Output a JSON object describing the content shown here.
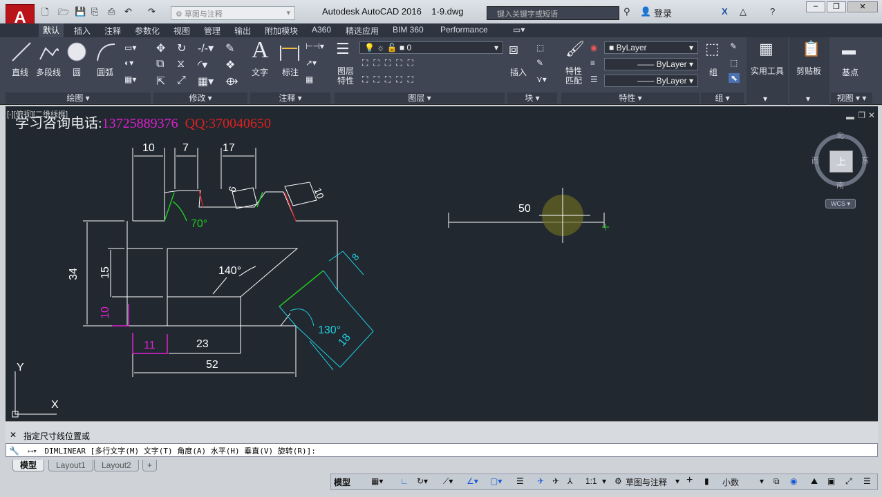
{
  "title": {
    "app": "Autodesk AutoCAD 2016",
    "file": "1-9.dwg",
    "workspace": "草图与注释"
  },
  "search": {
    "placeholder": "键入关键字或短语"
  },
  "user": {
    "login": "登录"
  },
  "tabs": [
    "默认",
    "插入",
    "注释",
    "参数化",
    "视图",
    "管理",
    "输出",
    "附加模块",
    "A360",
    "精选应用",
    "BIM 360",
    "Performance"
  ],
  "ribbon": {
    "draw": {
      "line": "直线",
      "polyline": "多段线",
      "circle": "圆",
      "arc": "圆弧",
      "title": "绘图"
    },
    "modify": {
      "title": "修改"
    },
    "annotation": {
      "text": "文字",
      "dim": "标注",
      "title": "注释"
    },
    "layers": {
      "props": "图层特性",
      "current": "0",
      "title": "图层"
    },
    "block": {
      "insert": "插入",
      "title": "块"
    },
    "properties": {
      "match": "特性匹配",
      "color": "ByLayer",
      "linetype": "ByLayer",
      "lineweight": "ByLayer",
      "title": "特性"
    },
    "group": {
      "group": "组",
      "title": "组"
    },
    "utilities": {
      "label": "实用工具"
    },
    "clipboard": {
      "label": "剪贴板"
    },
    "view": {
      "base": "基点",
      "title": "视图"
    }
  },
  "canvas": {
    "viewport_label": "[-][俯视][二维线框]",
    "contact_prefix": "学习咨询电话:",
    "phone": "13725889376",
    "qq": "QQ:370040650",
    "dims": {
      "d10": "10",
      "d7": "7",
      "d17": "17",
      "d6": "6",
      "d10b": "10",
      "d70": "70°",
      "d34": "34",
      "d15": "15",
      "d140": "140°",
      "d8": "8",
      "d10c": "10",
      "d130": "130°",
      "d11": "11",
      "d23": "23",
      "d18": "18",
      "d52": "52",
      "d50": "50"
    },
    "axis": {
      "y": "Y",
      "x": "X"
    },
    "viewcube": {
      "n": "北",
      "s": "南",
      "e": "东",
      "w": "西",
      "top": "上",
      "wcs": "WCS"
    }
  },
  "command": {
    "prompt": "指定尺寸线位置或",
    "line": "DIMLINEAR [多行文字(M) 文字(T) 角度(A) 水平(H) 垂直(V) 旋转(R)]:"
  },
  "layouts": [
    "模型",
    "Layout1",
    "Layout2"
  ],
  "status": {
    "model": "模型",
    "scale": "1:1",
    "workspace": "草图与注释",
    "units": "小数"
  }
}
